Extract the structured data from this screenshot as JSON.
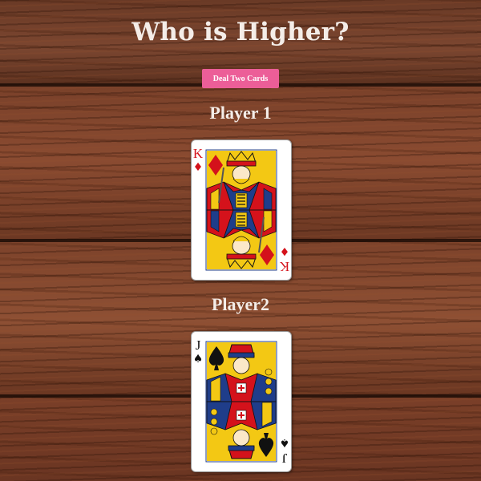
{
  "page": {
    "title": "Who is Higher?"
  },
  "controls": {
    "deal_label": "Deal Two Cards",
    "deal_color": "#ec5e98"
  },
  "players": [
    {
      "label": "Player 1",
      "card": {
        "rank": "K",
        "suit": "diamonds",
        "suit_symbol": "♦",
        "color": "#d4121b"
      }
    },
    {
      "label": "Player2",
      "card": {
        "rank": "J",
        "suit": "spades",
        "suit_symbol": "♠",
        "color": "#111111"
      }
    }
  ]
}
